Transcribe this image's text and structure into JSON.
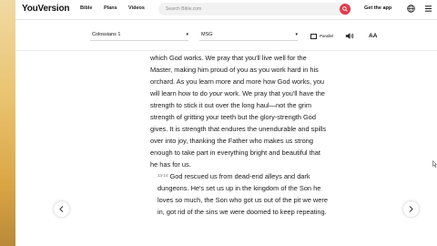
{
  "header": {
    "logo": "YouVersion",
    "nav": [
      "Bible",
      "Plans",
      "Videos"
    ],
    "search_placeholder": "Search Bible.com",
    "get_app": "Get the app"
  },
  "toolbar": {
    "book_selector": "Colossians 1",
    "version_selector": "MSG",
    "parallel_label": "Parallel",
    "font_size_label": "AA"
  },
  "passage": {
    "p1": "which God works. We pray that you'll live well for the Master, making him proud of you as you work hard in his orchard. As you learn more and more how God works, you will learn how to do ",
    "p1_italic": "your",
    "p1_end": " work. We pray that you'll have the strength to stick it out over the long haul—not the grim strength of gritting your teeth but the glory-strength God gives. It is strength that endures the unendurable and spills over into joy, thanking the Father who makes us strong enough to take part in everything bright and beautiful that he has for us.",
    "verse2_num": "13-14",
    "p2": "God rescued us from dead-end alleys and dark dungeons. He's set us up in the kingdom of the Son he loves so much, the Son who got us out of the pit we were in, got rid of the sins we were doomed to keep repeating."
  },
  "icons": {
    "search": "search-icon",
    "globe": "globe-icon",
    "menu": "menu-icon",
    "audio": "speaker-icon",
    "prev": "chevron-left-icon",
    "next": "chevron-right-icon"
  },
  "colors": {
    "accent": "#e23b4c"
  }
}
